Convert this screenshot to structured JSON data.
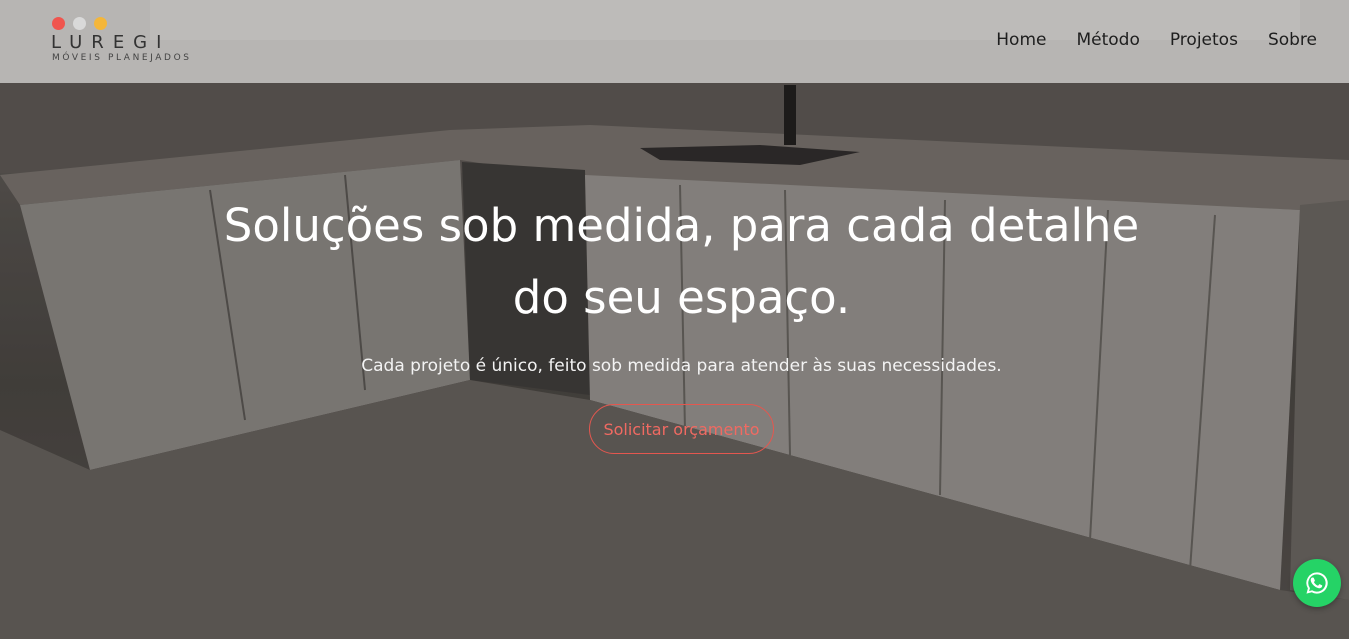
{
  "brand": {
    "name": "LUREGI",
    "tagline": "MÓVEIS PLANEJADOS",
    "dot_colors": [
      "#f0554e",
      "#d9d9d9",
      "#f4b63a"
    ]
  },
  "nav": {
    "items": [
      {
        "label": "Home"
      },
      {
        "label": "Método"
      },
      {
        "label": "Projetos"
      },
      {
        "label": "Sobre"
      }
    ]
  },
  "hero": {
    "title_line1": "Soluções sob medida, para cada detalhe",
    "title_line2": "do seu espaço.",
    "subtitle": "Cada projeto é único, feito sob medida para atender às suas necessidades.",
    "cta_label": "Solicitar orçamento",
    "cta_color": "#e4574f",
    "background_image": "kitchen-cabinets-photo"
  },
  "floating": {
    "whatsapp_icon": "whatsapp-icon",
    "whatsapp_color": "#25d366"
  }
}
